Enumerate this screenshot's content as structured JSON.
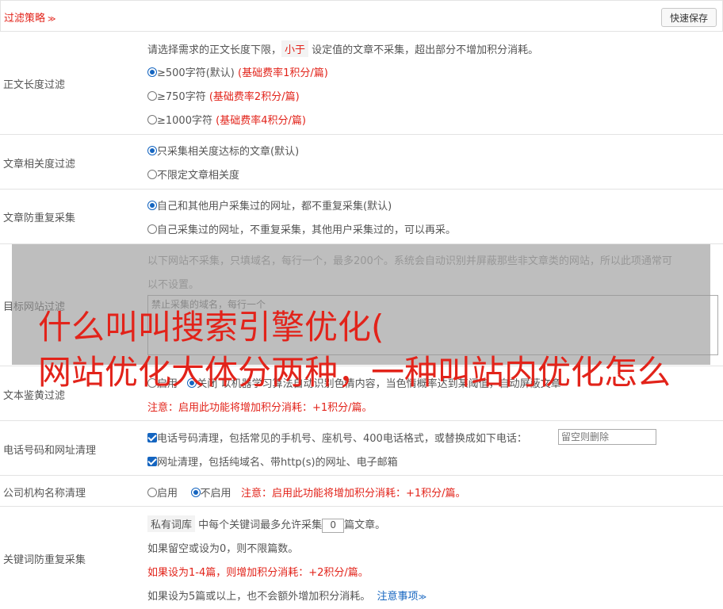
{
  "header": {
    "title": "过滤策略",
    "quick_save": "快速保存"
  },
  "length_filter": {
    "label": "正文长度过滤",
    "desc_pre": "请选择需求的正文长度下限，",
    "desc_chip": "小于",
    "desc_post": " 设定值的文章不采集，超出部分不增加积分消耗。",
    "options": [
      {
        "text": "≥500字符(默认)",
        "note": " (基础费率1积分/篇)",
        "checked": true
      },
      {
        "text": "≥750字符",
        "note": " (基础费率2积分/篇)",
        "checked": false
      },
      {
        "text": "≥1000字符",
        "note": " (基础费率4积分/篇)",
        "checked": false
      }
    ]
  },
  "relevance_filter": {
    "label": "文章相关度过滤",
    "options": [
      {
        "text": "只采集相关度达标的文章(默认)",
        "checked": true
      },
      {
        "text": "不限定文章相关度",
        "checked": false
      }
    ]
  },
  "dup_filter": {
    "label": "文章防重复采集",
    "options": [
      {
        "text": "自己和其他用户采集过的网址，都不重复采集(默认)",
        "checked": true
      },
      {
        "text": "自己采集过的网址，不重复采集，其他用户采集过的，可以再采。",
        "checked": false
      }
    ]
  },
  "site_filter": {
    "label": "目标网站过滤",
    "desc_line1": "以下网站不采集，只填域名，每行一个，最多200个。系统会自动识别并屏蔽那些非文章类的网站，所以此项通常可",
    "desc_line2": "以不设置。",
    "placeholder": "禁止采集的域名，每行一个"
  },
  "porn_filter": {
    "label": "文本鉴黄过滤",
    "opt_on": "启用",
    "opt_off": "关闭",
    "desc_tail": "以机器学习算法自动识别色情内容，当色情概率达到某阈值，自动屏蔽文章",
    "note": "注意：启用此功能将增加积分消耗：+1积分/篇。"
  },
  "contact_clean": {
    "label": "电话号码和网址清理",
    "phone_text": "电话号码清理，包括常见的手机号、座机号、400电话格式，或替换成如下电话：",
    "phone_placeholder": "留空则删除",
    "url_text": "网址清理，包括纯域名、带http(s)的网址、电子邮箱"
  },
  "org_clean": {
    "label": "公司机构名称清理",
    "opt_on": "启用",
    "opt_off": "不启用",
    "note": "注意：启用此功能将增加积分消耗：+1积分/篇。"
  },
  "keyword_dup": {
    "label": "关键词防重复采集",
    "chip": "私有词库",
    "line1_mid": " 中每个关键词最多允许采集",
    "value": "0",
    "line1_post": "篇文章。",
    "line2": "如果留空或设为0，则不限篇数。",
    "line3": "如果设为1-4篇，则增加积分消耗：+2积分/篇。",
    "line4": "如果设为5篇或以上，也不会额外增加积分消耗。",
    "link": "注意事项"
  },
  "overlay": {
    "line1": "什么叫叫搜索引擎优化(",
    "line2": "网站优化大体分两种，一种叫站内优化怎么"
  },
  "colors": {
    "accent_red": "#e2231a",
    "link_blue": "#1565c0",
    "border": "#e3e3e3"
  }
}
